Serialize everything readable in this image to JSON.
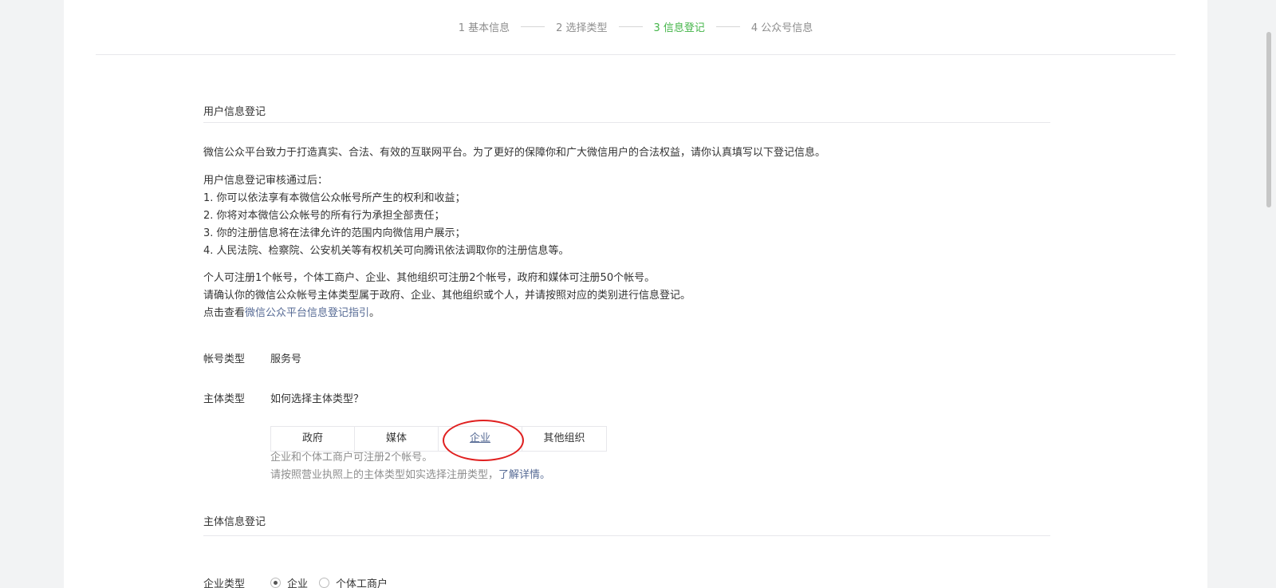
{
  "steps": [
    "1 基本信息",
    "2 选择类型",
    "3 信息登记",
    "4 公众号信息"
  ],
  "active_step": 2,
  "section1": {
    "title": "用户信息登记",
    "intro": "微信公众平台致力于打造真实、合法、有效的互联网平台。为了更好的保障你和广大微信用户的合法权益，请你认真填写以下登记信息。",
    "after_title": "用户信息登记审核通过后：",
    "items": [
      "1. 你可以依法享有本微信公众帐号所产生的权利和收益；",
      "2. 你将对本微信公众帐号的所有行为承担全部责任；",
      "3. 你的注册信息将在法律允许的范围内向微信用户展示；",
      "4. 人民法院、检察院、公安机关等有权机关可向腾讯依法调取你的注册信息等。"
    ],
    "limit_text": "个人可注册1个帐号，个体工商户、企业、其他组织可注册2个帐号，政府和媒体可注册50个帐号。",
    "confirm_text": "请确认你的微信公众帐号主体类型属于政府、企业、其他组织或个人，并请按照对应的类别进行信息登记。",
    "guide_prefix": "点击查看",
    "guide_link": "微信公众平台信息登记指引",
    "guide_suffix": "。"
  },
  "account_type": {
    "label": "帐号类型",
    "value": "服务号"
  },
  "subject_type": {
    "label": "主体类型",
    "help_link": "如何选择主体类型？",
    "options": [
      "政府",
      "媒体",
      "企业",
      "其他组织"
    ],
    "selected": 2,
    "hint1": "企业和个体工商户可注册2个帐号。",
    "hint2_prefix": "请按照营业执照上的主体类型如实选择注册类型，",
    "hint2_link": "了解详情。"
  },
  "section2": {
    "title": "主体信息登记"
  },
  "enterprise_type": {
    "label": "企业类型",
    "options": [
      "企业",
      "个体工商户"
    ],
    "selected": 0
  },
  "colors": {
    "accent": "#44b549",
    "link": "#576b95",
    "highlight": "#e02020"
  }
}
